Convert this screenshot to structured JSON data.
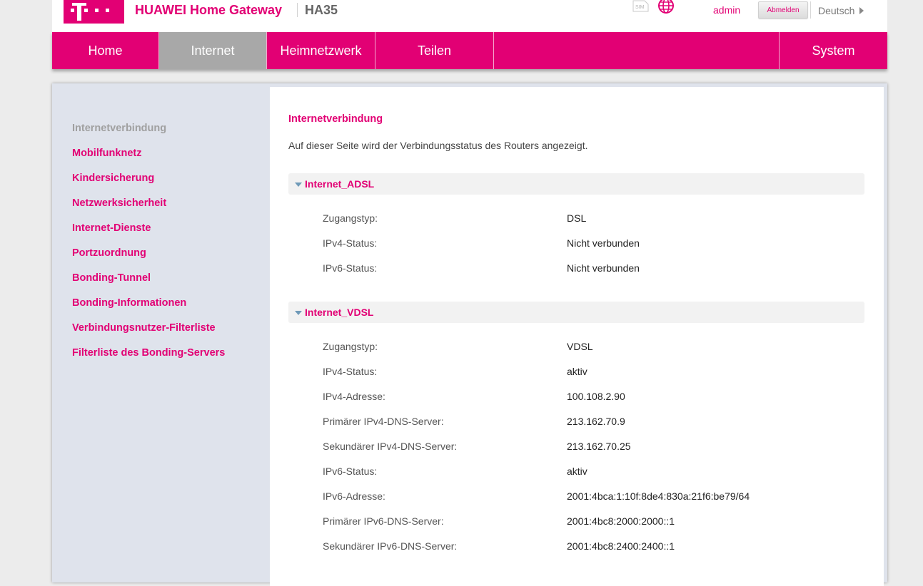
{
  "header": {
    "logo": "T · · ·",
    "product": "HUAWEI Home Gateway",
    "model": "HA35",
    "sim_icon": "sim-icon",
    "globe_icon": "globe-icon",
    "user": "admin",
    "logout_label": "Abmelden",
    "language": "Deutsch",
    "brand_color": "#e20074"
  },
  "nav": {
    "items": [
      {
        "label": "Home"
      },
      {
        "label": "Internet",
        "active": true
      },
      {
        "label": "Heimnetzwerk"
      },
      {
        "label": "Teilen"
      },
      {
        "label": "System"
      }
    ]
  },
  "sidebar": {
    "items": [
      {
        "label": "Internetverbindung",
        "current": true
      },
      {
        "label": "Mobilfunknetz"
      },
      {
        "label": "Kindersicherung"
      },
      {
        "label": "Netzwerksicherheit"
      },
      {
        "label": "Internet-Dienste"
      },
      {
        "label": "Portzuordnung"
      },
      {
        "label": "Bonding-Tunnel"
      },
      {
        "label": "Bonding-Informationen"
      },
      {
        "label": "Verbindungsnutzer-Filterliste"
      },
      {
        "label": "Filterliste des Bonding-Servers"
      }
    ]
  },
  "main": {
    "title": "Internetverbindung",
    "description": "Auf dieser Seite wird der Verbindungsstatus des Routers angezeigt.",
    "sections": [
      {
        "title": "Internet_ADSL",
        "rows": [
          {
            "label": "Zugangstyp:",
            "value": "DSL"
          },
          {
            "label": "IPv4-Status:",
            "value": "Nicht verbunden"
          },
          {
            "label": "IPv6-Status:",
            "value": "Nicht verbunden"
          }
        ]
      },
      {
        "title": "Internet_VDSL",
        "rows": [
          {
            "label": "Zugangstyp:",
            "value": "VDSL"
          },
          {
            "label": "IPv4-Status:",
            "value": "aktiv"
          },
          {
            "label": "IPv4-Adresse:",
            "value": "100.108.2.90"
          },
          {
            "label": "Primärer IPv4-DNS-Server:",
            "value": "213.162.70.9"
          },
          {
            "label": "Sekundärer IPv4-DNS-Server:",
            "value": "213.162.70.25"
          },
          {
            "label": "IPv6-Status:",
            "value": "aktiv"
          },
          {
            "label": "IPv6-Adresse:",
            "value": "2001:4bca:1:10f:8de4:830a:21f6:be79/64"
          },
          {
            "label": "Primärer IPv6-DNS-Server:",
            "value": "2001:4bc8:2000:2000::1"
          },
          {
            "label": "Sekundärer IPv6-DNS-Server:",
            "value": "2001:4bc8:2400:2400::1"
          }
        ]
      }
    ]
  }
}
